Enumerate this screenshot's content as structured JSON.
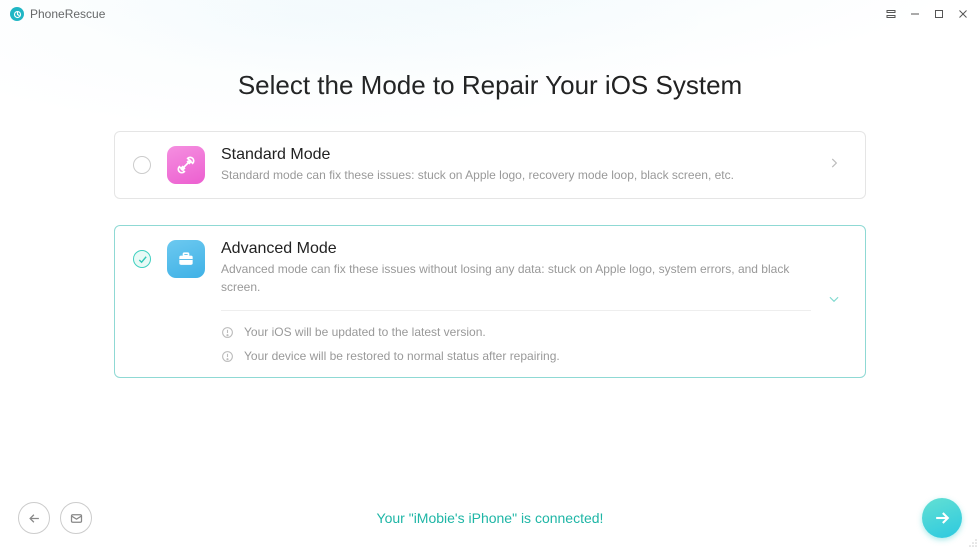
{
  "app": {
    "name": "PhoneRescue"
  },
  "heading": "Select the Mode to Repair Your iOS System",
  "modes": {
    "standard": {
      "title": "Standard Mode",
      "desc": "Standard mode can fix these issues: stuck on Apple logo, recovery mode loop, black screen, etc.",
      "selected": false
    },
    "advanced": {
      "title": "Advanced Mode",
      "desc": "Advanced mode can fix these issues without losing any data: stuck on Apple logo, system errors, and black screen.",
      "selected": true,
      "notes": [
        "Your iOS will be updated to the latest version.",
        "Your device will be restored to normal status after repairing."
      ]
    }
  },
  "footer": {
    "status": "Your \"iMobie's iPhone\" is connected!"
  },
  "colors": {
    "accent": "#1fb6a6",
    "pink": "#ec5fd0",
    "blue": "#3fb1e6"
  }
}
